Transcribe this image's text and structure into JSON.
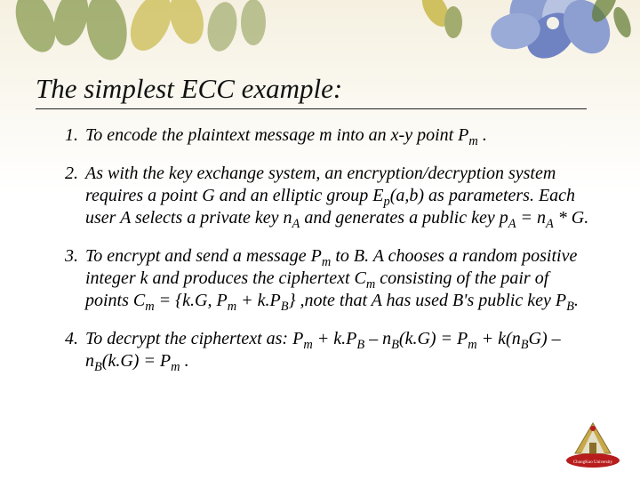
{
  "title": "The simplest ECC example:",
  "items": [
    {
      "num": "1.",
      "html": "To encode the plaintext message m into an x-y point P<span class='sub'>m</span> ."
    },
    {
      "num": "2.",
      "html": "As with the key exchange system, an encryption/decryption system requires a point G and an elliptic group E<span class='sub'>p</span>(a,b) as parameters. Each user A selects a private key n<span class='sub'>A</span> and generates a public key p<span class='sub'>A</span> = n<span class='sub'>A</span> * G."
    },
    {
      "num": "3.",
      "html": "To encrypt and send a message P<span class='sub'>m</span> to B.  A chooses a random positive integer k and produces the ciphertext C<span class='sub'>m</span> consisting of the pair of points C<span class='sub'>m</span> = {k.G, P<span class='sub'>m</span> + k.P<span class='sub'>B</span>}  ,note that A has used B's public key P<span class='sub'>B</span>."
    },
    {
      "num": "4.",
      "html": "To decrypt the ciphertext as:  P<span class='sub'>m</span> + k.P<span class='sub'>B</span> – n<span class='sub'>B</span>(k.G) = P<span class='sub'>m</span> + k(n<span class='sub'>B</span>G) – n<span class='sub'>B</span>(k.G) = P<span class='sub'>m</span> ."
    }
  ],
  "logo_text": "ChungKuo University",
  "colors": {
    "leaf_green": "#7a8f3a",
    "leaf_olive": "#94a05a",
    "leaf_yellow": "#c9b94a",
    "petal_blue": "#8d9fd0",
    "petal_light": "#b8c3e2",
    "logo_red": "#b81c1c",
    "logo_gold": "#c7a94b"
  }
}
